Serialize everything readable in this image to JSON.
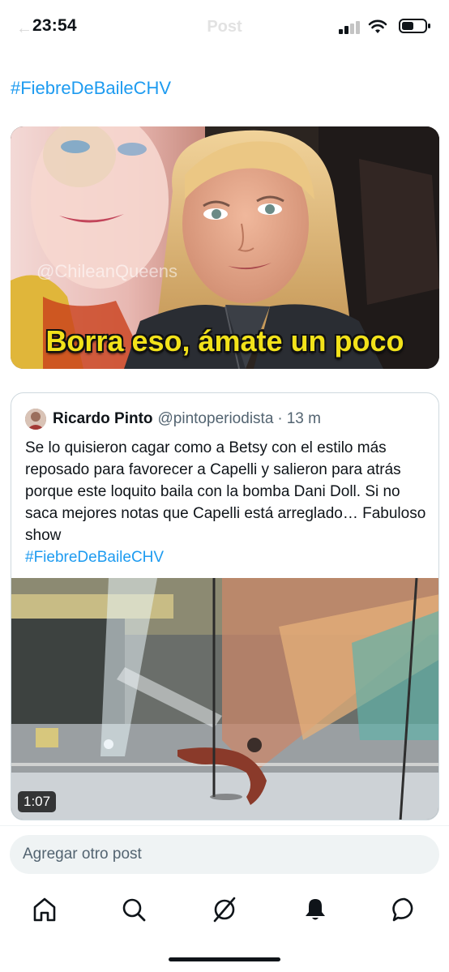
{
  "status_bar": {
    "time": "23:54",
    "header_title": "Post"
  },
  "post": {
    "hashtag": "#FiebreDeBaileCHV",
    "media": {
      "watermark": "@ChileanQueens",
      "caption": "Borra eso, ámate un poco"
    },
    "quoted": {
      "author_name": "Ricardo Pinto",
      "author_handle": "@pintoperiodista",
      "separator": "·",
      "time": "13 m",
      "text": "Se lo quisieron cagar como a Betsy con el estilo más reposado para favorecer a Capelli y salieron para atrás porque este loquito baila con la bomba Dani Doll. Si no saca mejores notas que Capelli está arreglado… Fabuloso show",
      "hashtag": "#FiebreDeBaileCHV",
      "video_duration": "1:07"
    }
  },
  "composer": {
    "placeholder": "Agregar otro post"
  },
  "tabbar": {
    "items": [
      "home-icon",
      "search-icon",
      "grok-icon",
      "notifications-icon",
      "messages-icon"
    ]
  },
  "colors": {
    "accent": "#1d9bf0",
    "caption_yellow": "#f2e21a",
    "text_primary": "#0f1419",
    "text_secondary": "#536471"
  }
}
